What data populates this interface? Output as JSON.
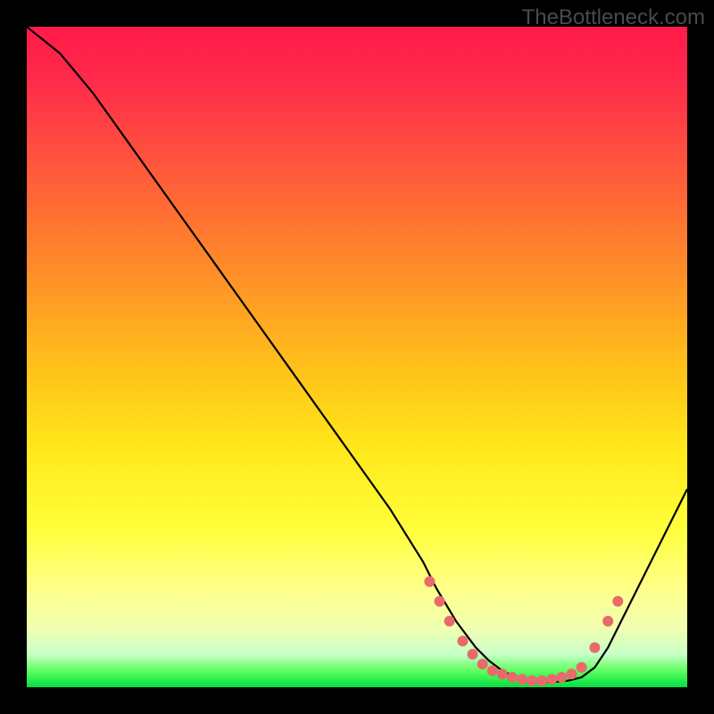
{
  "watermark": "TheBottleneck.com",
  "chart_data": {
    "type": "line",
    "title": "",
    "xlabel": "",
    "ylabel": "",
    "xlim": [
      0,
      100
    ],
    "ylim": [
      0,
      100
    ],
    "grid": false,
    "series": [
      {
        "name": "curve",
        "color": "#000000",
        "x": [
          0,
          5,
          10,
          15,
          20,
          25,
          30,
          35,
          40,
          45,
          50,
          55,
          60,
          62,
          65,
          68,
          70,
          72,
          74,
          76,
          78,
          80,
          82,
          84,
          86,
          88,
          90,
          92,
          95,
          100
        ],
        "values": [
          100,
          96,
          90,
          83,
          76,
          69,
          62,
          55,
          48,
          41,
          34,
          27,
          19,
          15,
          10,
          6,
          4,
          2.5,
          1.5,
          1,
          0.8,
          0.8,
          1,
          1.5,
          3,
          6,
          10,
          14,
          20,
          30
        ]
      }
    ],
    "markers": [
      {
        "name": "bottom-dots",
        "color": "#e86a6a",
        "shape": "circle",
        "x": [
          61,
          62.5,
          64,
          66,
          67.5,
          69,
          70.5,
          72,
          73.5,
          75,
          76.5,
          78,
          79.5,
          81,
          82.5,
          84,
          86,
          88,
          89.5
        ],
        "y": [
          16,
          13,
          10,
          7,
          5,
          3.5,
          2.5,
          2,
          1.5,
          1.2,
          1,
          1,
          1.2,
          1.5,
          2,
          3,
          6,
          10,
          13
        ]
      }
    ],
    "background_gradient": {
      "stops": [
        {
          "offset": 0,
          "color": "#ff1a4a"
        },
        {
          "offset": 0.5,
          "color": "#ffc21a"
        },
        {
          "offset": 0.85,
          "color": "#ffff8a"
        },
        {
          "offset": 1.0,
          "color": "#00e040"
        }
      ]
    }
  }
}
